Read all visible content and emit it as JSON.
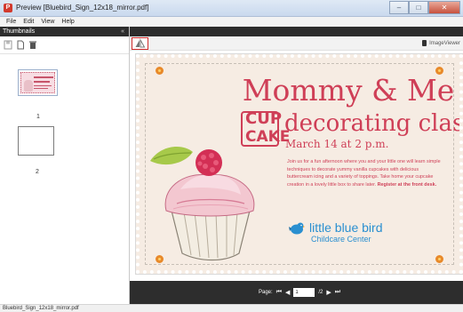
{
  "window": {
    "title": "Preview [Bluebird_Sign_12x18_mirror.pdf]",
    "controls": {
      "minimize": "–",
      "maximize": "□",
      "close": "✕"
    }
  },
  "menubar": {
    "items": [
      "File",
      "Edit",
      "View",
      "Help"
    ]
  },
  "sidebar": {
    "header": "Thumbnails",
    "collapse_glyph": "«",
    "toolbar_icons": [
      "save-icon",
      "new-page-icon",
      "delete-icon"
    ],
    "thumbnails": [
      {
        "number": "1"
      },
      {
        "number": "2"
      }
    ]
  },
  "viewer": {
    "brand": "ImageViewer",
    "page_nav": {
      "label": "Page:",
      "current_page": "1",
      "total": "/2"
    }
  },
  "document": {
    "headline": "Mommy & Me",
    "cup": "CUP",
    "cake": "CAKE",
    "subhead": "decorating class",
    "date": "March 14 at 2 p.m.",
    "body": "Join us for a fun afternoon where you and your little one will learn simple techniques to decorate yummy vanilla cupcakes with delicious buttercream icing and a variety of toppings. Take home your cupcake creation in a lovely little box to share later.",
    "register": "Register at the front desk.",
    "logo_name": "little blue bird",
    "logo_sub": "Childcare Center"
  },
  "status": {
    "text": "Bluebird_Sign_12x18_mirror.pdf"
  },
  "colors": {
    "accent_pink": "#cf3f57",
    "logo_blue": "#2a8fd0",
    "chrome_dark": "#2d2d2d"
  }
}
